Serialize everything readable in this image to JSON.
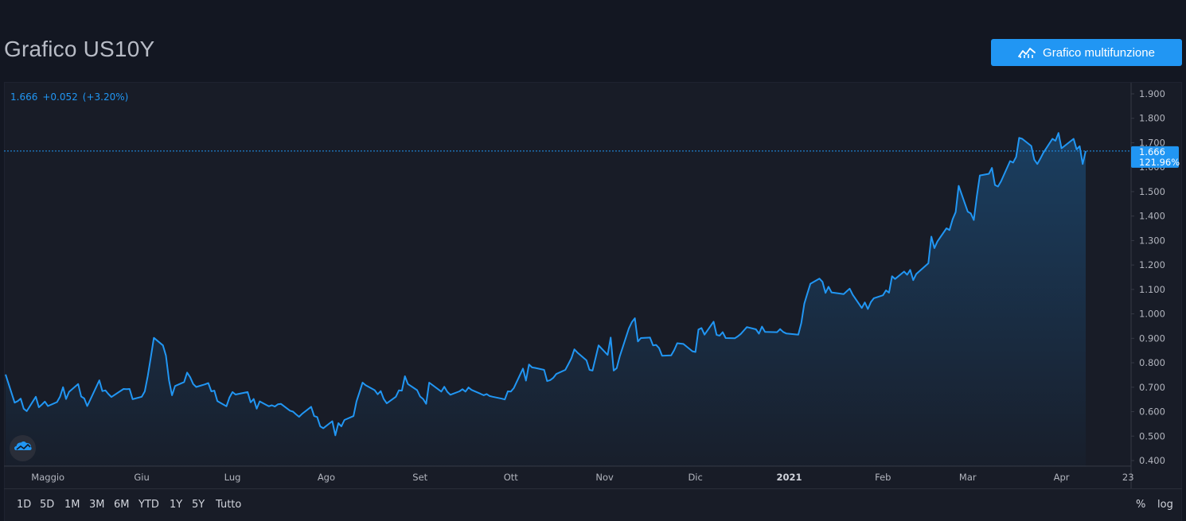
{
  "header": {
    "title": "Grafico US10Y",
    "button_label": "Grafico multifunzione",
    "button_icon": "chart-line-icon"
  },
  "legend": {
    "last": "1.666",
    "change": "+0.052",
    "change_pct": "(+3.20%)"
  },
  "price_label": {
    "value": "1.666",
    "pct": "121.96%"
  },
  "toolbar": {
    "ranges": [
      "1D",
      "5D",
      "1M",
      "3M",
      "6M",
      "YTD",
      "1Y",
      "5Y",
      "Tutto"
    ],
    "percent": "%",
    "log": "log"
  },
  "colors": {
    "line": "#2196f3",
    "background": "#131722",
    "pane": "#181c27"
  },
  "chart_data": {
    "type": "area",
    "symbol": "US10Y",
    "yticks": [
      "1.900",
      "1.800",
      "1.700",
      "1.600",
      "1.500",
      "1.400",
      "1.300",
      "1.200",
      "1.100",
      "1.000",
      "0.900",
      "0.800",
      "0.700",
      "0.600",
      "0.500",
      "0.400"
    ],
    "ylim": [
      0.4,
      1.9
    ],
    "xticks": [
      "Maggio",
      "Giu",
      "Lug",
      "Ago",
      "Set",
      "Ott",
      "Nov",
      "Dic",
      "2021",
      "Feb",
      "Mar",
      "Apr",
      "23"
    ],
    "x": [
      "2020-04-17",
      "2020-04-20",
      "2020-04-21",
      "2020-04-22",
      "2020-04-23",
      "2020-04-24",
      "2020-04-27",
      "2020-04-28",
      "2020-04-29",
      "2020-04-30",
      "2020-05-01",
      "2020-05-04",
      "2020-05-05",
      "2020-05-06",
      "2020-05-07",
      "2020-05-08",
      "2020-05-11",
      "2020-05-12",
      "2020-05-13",
      "2020-05-14",
      "2020-05-15",
      "2020-05-18",
      "2020-05-19",
      "2020-05-20",
      "2020-05-21",
      "2020-05-22",
      "2020-05-26",
      "2020-05-27",
      "2020-05-28",
      "2020-05-29",
      "2020-06-01",
      "2020-06-02",
      "2020-06-03",
      "2020-06-04",
      "2020-06-05",
      "2020-06-08",
      "2020-06-09",
      "2020-06-10",
      "2020-06-11",
      "2020-06-12",
      "2020-06-15",
      "2020-06-16",
      "2020-06-17",
      "2020-06-18",
      "2020-06-19",
      "2020-06-22",
      "2020-06-23",
      "2020-06-24",
      "2020-06-25",
      "2020-06-26",
      "2020-06-29",
      "2020-06-30",
      "2020-07-01",
      "2020-07-02",
      "2020-07-06",
      "2020-07-07",
      "2020-07-08",
      "2020-07-09",
      "2020-07-10",
      "2020-07-13",
      "2020-07-14",
      "2020-07-15",
      "2020-07-16",
      "2020-07-17",
      "2020-07-20",
      "2020-07-21",
      "2020-07-22",
      "2020-07-23",
      "2020-07-24",
      "2020-07-27",
      "2020-07-28",
      "2020-07-29",
      "2020-07-30",
      "2020-07-31",
      "2020-08-03",
      "2020-08-04",
      "2020-08-05",
      "2020-08-06",
      "2020-08-07",
      "2020-08-10",
      "2020-08-11",
      "2020-08-12",
      "2020-08-13",
      "2020-08-14",
      "2020-08-17",
      "2020-08-18",
      "2020-08-19",
      "2020-08-20",
      "2020-08-21",
      "2020-08-24",
      "2020-08-25",
      "2020-08-26",
      "2020-08-27",
      "2020-08-28",
      "2020-08-31",
      "2020-09-01",
      "2020-09-02",
      "2020-09-03",
      "2020-09-04",
      "2020-09-08",
      "2020-09-09",
      "2020-09-10",
      "2020-09-11",
      "2020-09-14",
      "2020-09-15",
      "2020-09-16",
      "2020-09-17",
      "2020-09-18",
      "2020-09-21",
      "2020-09-22",
      "2020-09-23",
      "2020-09-24",
      "2020-09-25",
      "2020-09-28",
      "2020-09-29",
      "2020-09-30",
      "2020-10-01",
      "2020-10-02",
      "2020-10-05",
      "2020-10-06",
      "2020-10-07",
      "2020-10-08",
      "2020-10-09",
      "2020-10-12",
      "2020-10-13",
      "2020-10-14",
      "2020-10-15",
      "2020-10-16",
      "2020-10-19",
      "2020-10-20",
      "2020-10-21",
      "2020-10-22",
      "2020-10-23",
      "2020-10-26",
      "2020-10-27",
      "2020-10-28",
      "2020-10-29",
      "2020-10-30",
      "2020-11-02",
      "2020-11-03",
      "2020-11-04",
      "2020-11-05",
      "2020-11-06",
      "2020-11-09",
      "2020-11-10",
      "2020-11-11",
      "2020-11-12",
      "2020-11-13",
      "2020-11-16",
      "2020-11-17",
      "2020-11-18",
      "2020-11-19",
      "2020-11-20",
      "2020-11-23",
      "2020-11-24",
      "2020-11-25",
      "2020-11-27",
      "2020-11-30",
      "2020-12-01",
      "2020-12-02",
      "2020-12-03",
      "2020-12-04",
      "2020-12-07",
      "2020-12-08",
      "2020-12-09",
      "2020-12-10",
      "2020-12-11",
      "2020-12-14",
      "2020-12-15",
      "2020-12-16",
      "2020-12-17",
      "2020-12-18",
      "2020-12-21",
      "2020-12-22",
      "2020-12-23",
      "2020-12-24",
      "2020-12-28",
      "2020-12-29",
      "2020-12-30",
      "2020-12-31",
      "2021-01-04",
      "2021-01-05",
      "2021-01-06",
      "2021-01-07",
      "2021-01-08",
      "2021-01-11",
      "2021-01-12",
      "2021-01-13",
      "2021-01-14",
      "2021-01-15",
      "2021-01-19",
      "2021-01-20",
      "2021-01-21",
      "2021-01-22",
      "2021-01-25",
      "2021-01-26",
      "2021-01-27",
      "2021-01-28",
      "2021-01-29",
      "2021-02-01",
      "2021-02-02",
      "2021-02-03",
      "2021-02-04",
      "2021-02-05",
      "2021-02-08",
      "2021-02-09",
      "2021-02-10",
      "2021-02-11",
      "2021-02-12",
      "2021-02-16",
      "2021-02-17",
      "2021-02-18",
      "2021-02-19",
      "2021-02-22",
      "2021-02-23",
      "2021-02-24",
      "2021-02-25",
      "2021-02-26",
      "2021-03-01",
      "2021-03-02",
      "2021-03-03",
      "2021-03-04",
      "2021-03-05",
      "2021-03-08",
      "2021-03-09",
      "2021-03-10",
      "2021-03-11",
      "2021-03-12",
      "2021-03-15",
      "2021-03-16",
      "2021-03-17",
      "2021-03-18",
      "2021-03-19",
      "2021-03-22",
      "2021-03-23",
      "2021-03-24",
      "2021-03-25",
      "2021-03-26",
      "2021-03-29",
      "2021-03-30",
      "2021-03-31",
      "2021-04-01",
      "2021-04-05",
      "2021-04-06",
      "2021-04-07",
      "2021-04-08",
      "2021-04-09"
    ],
    "y": [
      0.752,
      0.637,
      0.643,
      0.653,
      0.612,
      0.602,
      0.661,
      0.618,
      0.629,
      0.641,
      0.623,
      0.639,
      0.661,
      0.7,
      0.652,
      0.681,
      0.713,
      0.662,
      0.654,
      0.623,
      0.649,
      0.728,
      0.684,
      0.687,
      0.672,
      0.66,
      0.693,
      0.692,
      0.693,
      0.651,
      0.661,
      0.683,
      0.747,
      0.823,
      0.902,
      0.871,
      0.829,
      0.729,
      0.667,
      0.705,
      0.721,
      0.76,
      0.741,
      0.713,
      0.701,
      0.712,
      0.717,
      0.683,
      0.686,
      0.643,
      0.622,
      0.658,
      0.68,
      0.67,
      0.68,
      0.638,
      0.652,
      0.612,
      0.642,
      0.622,
      0.626,
      0.621,
      0.63,
      0.632,
      0.604,
      0.6,
      0.589,
      0.579,
      0.591,
      0.62,
      0.582,
      0.578,
      0.54,
      0.532,
      0.561,
      0.503,
      0.553,
      0.54,
      0.566,
      0.582,
      0.642,
      0.68,
      0.719,
      0.708,
      0.688,
      0.671,
      0.684,
      0.652,
      0.634,
      0.661,
      0.687,
      0.686,
      0.745,
      0.713,
      0.688,
      0.662,
      0.652,
      0.632,
      0.719,
      0.682,
      0.702,
      0.681,
      0.669,
      0.683,
      0.692,
      0.682,
      0.699,
      0.689,
      0.673,
      0.667,
      0.672,
      0.664,
      0.661,
      0.653,
      0.65,
      0.683,
      0.682,
      0.697,
      0.776,
      0.727,
      0.793,
      0.781,
      0.779,
      0.771,
      0.725,
      0.729,
      0.738,
      0.754,
      0.771,
      0.794,
      0.818,
      0.855,
      0.842,
      0.81,
      0.771,
      0.768,
      0.819,
      0.871,
      0.832,
      0.903,
      0.768,
      0.778,
      0.826,
      0.94,
      0.966,
      0.982,
      0.887,
      0.901,
      0.903,
      0.871,
      0.873,
      0.86,
      0.829,
      0.83,
      0.852,
      0.88,
      0.877,
      0.847,
      0.844,
      0.936,
      0.942,
      0.915,
      0.968,
      0.914,
      0.911,
      0.925,
      0.901,
      0.9,
      0.908,
      0.918,
      0.932,
      0.946,
      0.937,
      0.919,
      0.948,
      0.926,
      0.925,
      0.938,
      0.926,
      0.92,
      0.915,
      0.963,
      1.042,
      1.083,
      1.123,
      1.144,
      1.131,
      1.086,
      1.111,
      1.088,
      1.081,
      1.092,
      1.103,
      1.078,
      1.024,
      1.047,
      1.02,
      1.048,
      1.064,
      1.076,
      1.096,
      1.087,
      1.154,
      1.143,
      1.173,
      1.16,
      1.18,
      1.138,
      1.163,
      1.207,
      1.316,
      1.269,
      1.296,
      1.35,
      1.343,
      1.387,
      1.416,
      1.524,
      1.418,
      1.411,
      1.384,
      1.481,
      1.566,
      1.573,
      1.597,
      1.527,
      1.521,
      1.542,
      1.625,
      1.619,
      1.642,
      1.72,
      1.716,
      1.687,
      1.631,
      1.613,
      1.635,
      1.659,
      1.716,
      1.708,
      1.74,
      1.677,
      1.716,
      1.673,
      1.686,
      1.613,
      1.666
    ]
  }
}
